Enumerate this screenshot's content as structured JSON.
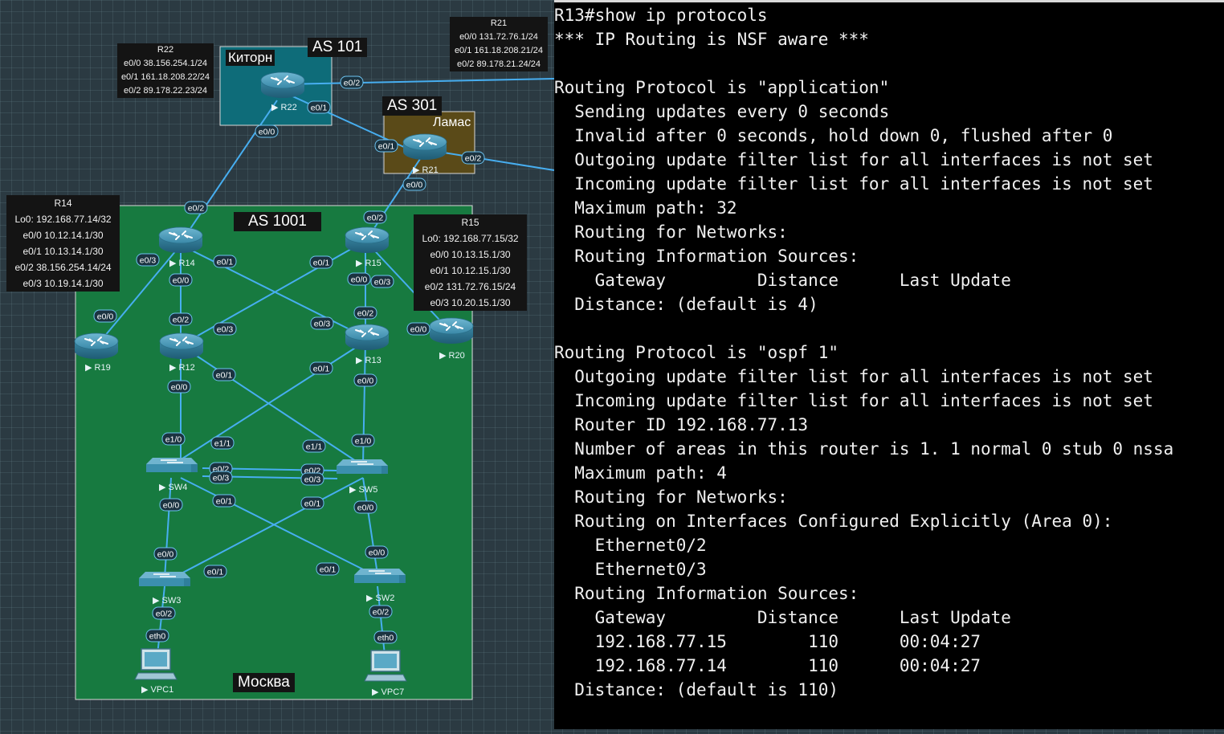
{
  "zones": {
    "as101": {
      "label": "AS 101",
      "sublabel": "Киторн"
    },
    "as301": {
      "label": "AS 301",
      "sublabel": "Ламас"
    },
    "as1001": {
      "label": "AS 1001",
      "sublabel": "Москва"
    }
  },
  "info_boxes": {
    "r22": [
      "R22",
      "e0/0 38.156.254.1/24",
      "e0/1 161.18.208.22/24",
      "e0/2 89.178.22.23/24"
    ],
    "r21": [
      "R21",
      "e0/0 131.72.76.1/24",
      "e0/1 161.18.208.21/24",
      "e0/2 89.178.21.24/24"
    ],
    "r14": [
      "R14",
      "Lo0: 192.168.77.14/32",
      "e0/0 10.12.14.1/30",
      "e0/1 10.13.14.1/30",
      "e0/2 38.156.254.14/24",
      "e0/3 10.19.14.1/30"
    ],
    "r15": [
      "R15",
      "Lo0: 192.168.77.15/32",
      "e0/0 10.13.15.1/30",
      "e0/1 10.12.15.1/30",
      "e0/2 131.72.76.15/24",
      "e0/3 10.20.15.1/30"
    ]
  },
  "nodes": {
    "r22": "R22",
    "r21": "R21",
    "r14": "R14",
    "r15": "R15",
    "r19": "R19",
    "r12": "R12",
    "r13": "R13",
    "r20": "R20",
    "sw4": "SW4",
    "sw5": "SW5",
    "sw3": "SW3",
    "sw2": "SW2",
    "vpc1": "VPC1",
    "vpc7": "VPC7"
  },
  "ports": {
    "r22_e02": "e0/2",
    "r22_e01": "e0/1",
    "r22_e00": "e0/0",
    "r21_e01": "e0/1",
    "r21_e02": "e0/2",
    "r21_e00": "e0/0",
    "r14_e02": "e0/2",
    "r14_e03": "e0/3",
    "r14_e01": "e0/1",
    "r14_e00": "e0/0",
    "r19_e00": "e0/0",
    "r15_e02": "e0/2",
    "r15_e01": "e0/1",
    "r15_e00": "e0/0",
    "r15_e03": "e0/3",
    "r12_e02": "e0/2",
    "r12_e03": "e0/3",
    "r12_e01": "e0/1",
    "r12_e00": "e0/0",
    "r13_e02": "e0/2",
    "r13_e03": "e0/3",
    "r13_e01": "e0/1",
    "r13_e00": "e0/0",
    "r20_e00": "e0/0",
    "sw4_e10": "e1/0",
    "sw4_e11": "e1/1",
    "sw4_e02": "e0/2",
    "sw4_e03": "e0/3",
    "sw4_e01": "e0/1",
    "sw4_e00": "e0/0",
    "sw5_e11": "e1/1",
    "sw5_e10": "e1/0",
    "sw5_e02": "e0/2",
    "sw5_e03": "e0/3",
    "sw5_e01": "e0/1",
    "sw5_e00": "e0/0",
    "sw3_e00": "e0/0",
    "sw3_e01": "e0/1",
    "sw3_e02": "e0/2",
    "sw2_e01": "e0/1",
    "sw2_e00": "e0/0",
    "sw2_e02": "e0/2",
    "vpc1_eth0": "eth0",
    "vpc7_eth0": "eth0"
  },
  "terminal": {
    "lines": [
      "R13#show ip protocols",
      "*** IP Routing is NSF aware ***",
      "",
      "Routing Protocol is \"application\"",
      "  Sending updates every 0 seconds",
      "  Invalid after 0 seconds, hold down 0, flushed after 0",
      "  Outgoing update filter list for all interfaces is not set",
      "  Incoming update filter list for all interfaces is not set",
      "  Maximum path: 32",
      "  Routing for Networks:",
      "  Routing Information Sources:",
      "    Gateway         Distance      Last Update",
      "  Distance: (default is 4)",
      "",
      "Routing Protocol is \"ospf 1\"",
      "  Outgoing update filter list for all interfaces is not set",
      "  Incoming update filter list for all interfaces is not set",
      "  Router ID 192.168.77.13",
      "  Number of areas in this router is 1. 1 normal 0 stub 0 nssa",
      "  Maximum path: 4",
      "  Routing for Networks:",
      "  Routing on Interfaces Configured Explicitly (Area 0):",
      "    Ethernet0/2",
      "    Ethernet0/3",
      "  Routing Information Sources:",
      "    Gateway         Distance      Last Update",
      "    192.168.77.15        110      00:04:27",
      "    192.168.77.14        110      00:04:27",
      "  Distance: (default is 110)"
    ]
  },
  "colors": {
    "as101_fill": "#0e6c79",
    "as301_fill": "#5a4a18",
    "as1001_fill": "#177a40",
    "link": "#47aef0",
    "router_body": "#3d8fae"
  }
}
